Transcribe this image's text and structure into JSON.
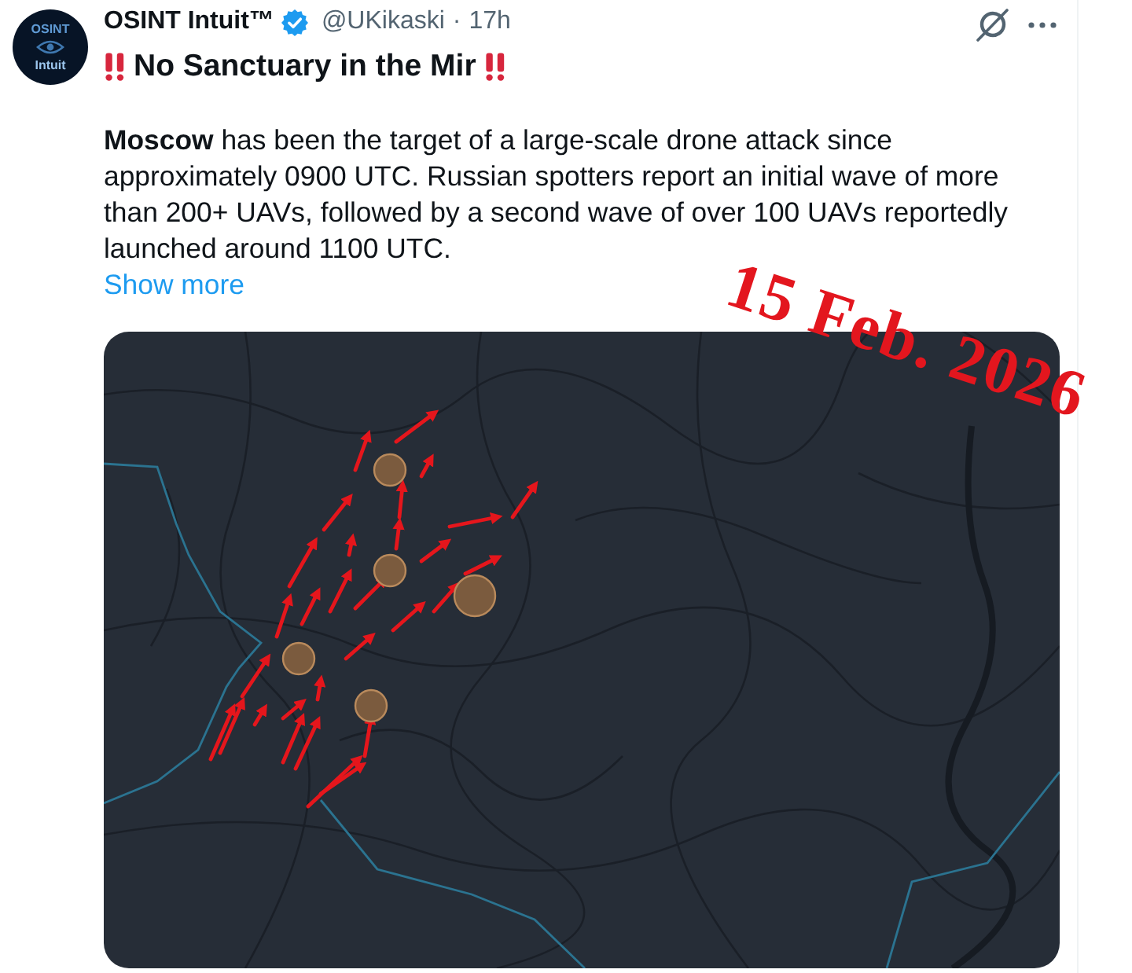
{
  "tweet": {
    "avatar": {
      "logo_top": "OSINT",
      "logo_bottom": "Intuit"
    },
    "author": {
      "name": "OSINT Intuit™",
      "verified": true,
      "handle": "@UKikaski",
      "separator": "·",
      "time": "17h"
    },
    "title": "No Sanctuary in the Mir",
    "text": "**Moscow** has been the target of a large-scale drone attack since approximately 0900 UTC. Russian spotters report an initial wave of more than 200+ UAVs, followed by a second wave of over 100 UAVs reportedly launched around 1100 UTC.",
    "show_more": "Show more",
    "annotation": "15 Feb. 2026"
  }
}
